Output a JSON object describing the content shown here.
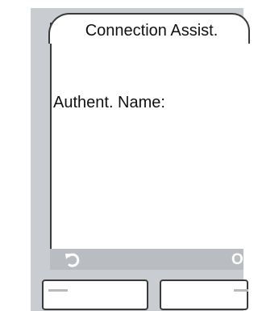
{
  "screen": {
    "title": "Connection Assist.",
    "field_label": "Authent. Name:"
  },
  "softkeys": {
    "left_icon": "back-icon",
    "right_label": "OK"
  },
  "colors": {
    "device_body": "#c9ccd0",
    "softkey_bar": "#b9bcc1",
    "screen": "#ffffff"
  }
}
